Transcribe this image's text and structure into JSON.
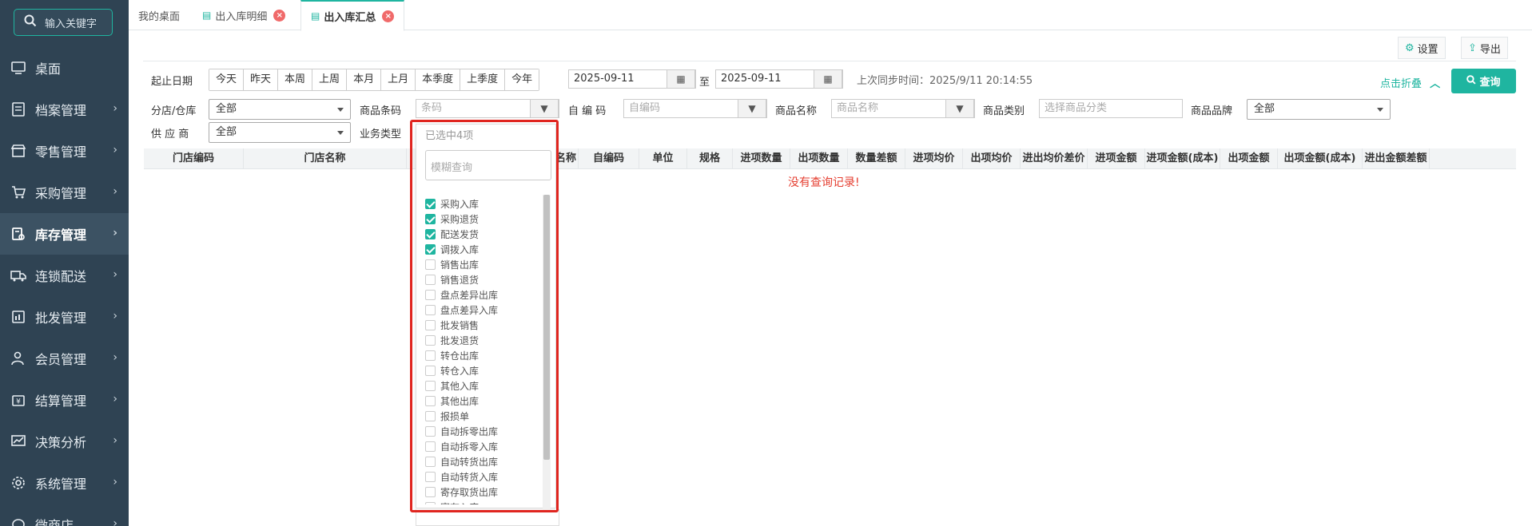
{
  "sidebar": {
    "search_placeholder": "输入关键字",
    "items": [
      {
        "label": "桌面",
        "icon": "monitor-icon"
      },
      {
        "label": "档案管理",
        "icon": "archive-icon"
      },
      {
        "label": "零售管理",
        "icon": "shop-icon"
      },
      {
        "label": "采购管理",
        "icon": "cart-icon"
      },
      {
        "label": "库存管理",
        "icon": "inventory-icon",
        "active": true
      },
      {
        "label": "连锁配送",
        "icon": "truck-icon"
      },
      {
        "label": "批发管理",
        "icon": "wholesale-icon"
      },
      {
        "label": "会员管理",
        "icon": "user-icon"
      },
      {
        "label": "结算管理",
        "icon": "settlement-icon"
      },
      {
        "label": "决策分析",
        "icon": "chart-icon"
      },
      {
        "label": "系统管理",
        "icon": "gear-icon"
      },
      {
        "label": "微商店",
        "icon": "wechat-shop-icon"
      }
    ]
  },
  "tabs": [
    {
      "label": "我的桌面"
    },
    {
      "label": "出入库明细"
    },
    {
      "label": "出入库汇总"
    }
  ],
  "toolbar": {
    "settings": "设置",
    "export": "导出"
  },
  "filters": {
    "date_label": "起止日期",
    "quick_dates": [
      "今天",
      "昨天",
      "本周",
      "上周",
      "本月",
      "上月",
      "本季度",
      "上季度",
      "今年"
    ],
    "start_date": "2025-09-11",
    "to": "至",
    "end_date": "2025-09-11",
    "last_sync": "上次同步时间：2025/9/11 20:14:55",
    "collapse": "点击折叠",
    "query": "查询",
    "store_label": "分店/仓库",
    "store_value": "全部",
    "barcode_label": "商品条码",
    "barcode_placeholder": "条码",
    "selfcode_label": "自 编 码",
    "selfcode_placeholder": "自编码",
    "name_label": "商品名称",
    "name_placeholder": "商品名称",
    "category_label": "商品类别",
    "category_placeholder": "选择商品分类",
    "brand_label": "商品品牌",
    "brand_value": "全部",
    "supplier_label": "供 应 商",
    "supplier_value": "全部",
    "biztype_label": "业务类型"
  },
  "table": {
    "columns": [
      "门店编码",
      "门店名称",
      "名称",
      "自编码",
      "单位",
      "规格",
      "进项数量",
      "出项数量",
      "数量差额",
      "进项均价",
      "出项均价",
      "进出均价差价",
      "进项金额",
      "进项金额(成本)",
      "出项金额",
      "出项金额(成本)",
      "进出金额差额"
    ],
    "empty": "没有查询记录!"
  },
  "dropdown": {
    "header": "已选中4项",
    "search_placeholder": "模糊查询",
    "options": [
      {
        "label": "采购入库",
        "checked": true
      },
      {
        "label": "采购退货",
        "checked": true
      },
      {
        "label": "配送发货",
        "checked": true
      },
      {
        "label": "调拨入库",
        "checked": true
      },
      {
        "label": "销售出库",
        "checked": false
      },
      {
        "label": "销售退货",
        "checked": false
      },
      {
        "label": "盘点差异出库",
        "checked": false
      },
      {
        "label": "盘点差异入库",
        "checked": false
      },
      {
        "label": "批发销售",
        "checked": false
      },
      {
        "label": "批发退货",
        "checked": false
      },
      {
        "label": "转仓出库",
        "checked": false
      },
      {
        "label": "转仓入库",
        "checked": false
      },
      {
        "label": "其他入库",
        "checked": false
      },
      {
        "label": "其他出库",
        "checked": false
      },
      {
        "label": "报损单",
        "checked": false
      },
      {
        "label": "自动拆零出库",
        "checked": false
      },
      {
        "label": "自动拆零入库",
        "checked": false
      },
      {
        "label": "自动转货出库",
        "checked": false
      },
      {
        "label": "自动转货入库",
        "checked": false
      },
      {
        "label": "寄存取货出库",
        "checked": false
      },
      {
        "label": "寄存入库",
        "checked": false
      }
    ]
  },
  "colors": {
    "accent": "#1fb5a0",
    "sidebar_bg": "#2f4353",
    "highlight": "#e0251f",
    "empty_text": "#e53e30"
  }
}
